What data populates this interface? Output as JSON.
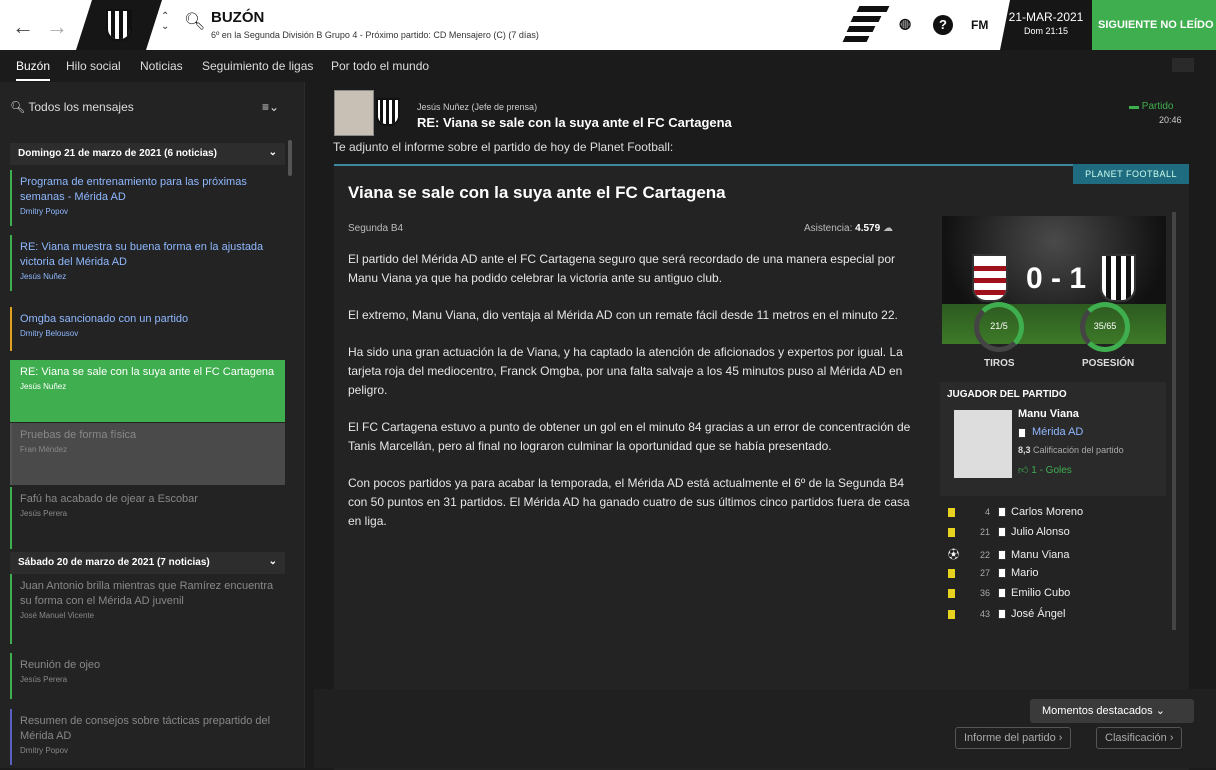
{
  "topbar": {
    "title": "BUZÓN",
    "subtitle": "6º en la Segunda División B Grupo 4 - Próximo partido: CD Mensajero (C) (7 días)",
    "date": "21-MAR-2021",
    "day": "Dom 21:15",
    "next_button": "SIGUIENTE NO LEÍDO",
    "fm": "FM",
    "help": "?",
    "back": "←",
    "forward": "→"
  },
  "tabs": [
    "Buzón",
    "Hilo social",
    "Noticias",
    "Seguimiento de ligas",
    "Por todo el mundo"
  ],
  "sidebar": {
    "search": "Todos los mensajes",
    "groups": [
      {
        "title": "Domingo 21 de marzo de 2021 (6 noticias)",
        "messages": [
          {
            "title": "Programa de entrenamiento para las próximas semanas - Mérida AD",
            "author": "Dmitry Popov",
            "color": "#3fae4f"
          },
          {
            "title": "RE: Viana muestra su buena forma en la ajustada victoria del Mérida AD",
            "author": "Jesús Nuñez",
            "color": "#3fae4f"
          },
          {
            "title": "Omgba sancionado con un partido",
            "author": "Dmitry Belousov",
            "color": "#e0a020"
          },
          {
            "title": "RE: Viana se sale con la suya ante el FC Cartagena",
            "author": "Jesús Nuñez",
            "color": "#3fae4f"
          },
          {
            "title": "Pruebas de forma física",
            "author": "Fran Méndez",
            "color": "#555"
          },
          {
            "title": "Fafú ha acabado de ojear a Escobar",
            "author": "Jesús Perera",
            "color": "#3fae4f"
          }
        ]
      },
      {
        "title": "Sábado 20 de marzo de 2021 (7 noticias)",
        "messages": [
          {
            "title": "Juan Antonio brilla mientras que Ramírez encuentra su forma con el Mérida AD juvenil",
            "author": "José Manuel Vicente",
            "color": "#3fae4f"
          },
          {
            "title": "Reunión de ojeo",
            "author": "Jesús Perera",
            "color": "#3fae4f"
          },
          {
            "title": "Resumen de consejos sobre tácticas prepartido del Mérida AD",
            "author": "Dmitry Popov",
            "color": "#5a60c0"
          }
        ]
      }
    ]
  },
  "message": {
    "from": "Jesús Nuñez  (Jefe de prensa)",
    "subject": "RE: Viana se sale con la suya ante el FC Cartagena",
    "status": "Partido",
    "time": "20:46",
    "intro": "Te adjunto el informe sobre el partido de hoy de Planet Football:"
  },
  "article": {
    "source": "PLANET FOOTBALL",
    "title": "Viana se sale con la suya ante el FC Cartagena",
    "competition": "Segunda B4",
    "attendance_label": "Asistencia:",
    "attendance": "4.579",
    "paragraphs": [
      "El partido del Mérida AD ante el FC Cartagena seguro que será recordado de una manera especial por Manu Viana ya que ha podido celebrar la victoria ante su antiguo club.",
      "El extremo, Manu Viana, dio ventaja al Mérida AD con un remate fácil desde 11 metros en el minuto 22.",
      "Ha sido una gran actuación la de Viana, y ha captado la atención de aficionados y expertos por igual. La tarjeta roja del mediocentro, Franck Omgba, por una falta salvaje a los 45 minutos puso al Mérida AD en peligro.",
      "El FC Cartagena estuvo a punto de obtener un gol en el minuto 84 gracias a un error de concentración de Tanis Marcellán, pero al final no lograron culminar la oportunidad que se había presentado.",
      "Con pocos partidos ya para acabar la temporada, el Mérida AD está actualmente el 6º de la Segunda B4 con 50 puntos en 31 partidos. El Mérida AD ha ganado cuatro de sus últimos cinco partidos fuera de casa en liga."
    ]
  },
  "match": {
    "score": "0 - 1",
    "shots": "21/5",
    "shots_label": "TIROS",
    "possession": "35/65",
    "possession_label": "POSESIÓN",
    "motm": {
      "header": "JUGADOR DEL PARTIDO",
      "name": "Manu Viana",
      "club": "Mérida AD",
      "rating": "8,3",
      "rating_label": "Calificación del partido",
      "goals": "1 - Goles"
    },
    "events": [
      {
        "type": "yellow",
        "minute": "4",
        "player": "Carlos Moreno"
      },
      {
        "type": "yellow",
        "minute": "21",
        "player": "Julio Alonso"
      },
      {
        "type": "goal",
        "minute": "22",
        "player": "Manu Viana"
      },
      {
        "type": "yellow",
        "minute": "27",
        "player": "Mario"
      },
      {
        "type": "yellow",
        "minute": "36",
        "player": "Emilio Cubo"
      },
      {
        "type": "yellow",
        "minute": "43",
        "player": "José Ángel"
      }
    ]
  },
  "bottom": {
    "moments": "Momentos destacados",
    "report": "Informe del partido",
    "table": "Clasificación"
  }
}
